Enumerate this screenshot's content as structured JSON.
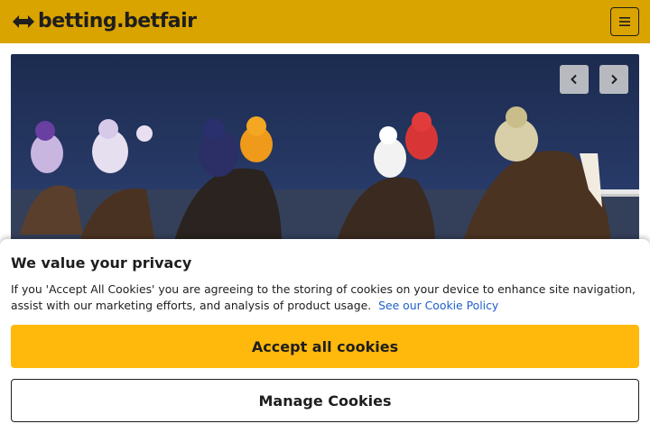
{
  "header": {
    "logo_text": "betting.betfair",
    "logo_icon": "betfair-arrows-icon",
    "menu_icon": "hamburger-menu-icon",
    "background": "#d9a300"
  },
  "hero": {
    "prev_icon": "chevron-left-icon",
    "next_icon": "chevron-right-icon"
  },
  "cookie_banner": {
    "title": "We value your privacy",
    "text": "If you 'Accept All Cookies' you are agreeing to the storing of cookies on your device to enhance site navigation, assist with our marketing efforts, and analysis of product usage.",
    "link_text": "See our Cookie Policy",
    "accept_label": "Accept all cookies",
    "manage_label": "Manage Cookies",
    "accent": "#ffb80c",
    "link_color": "#1f5fc9"
  }
}
